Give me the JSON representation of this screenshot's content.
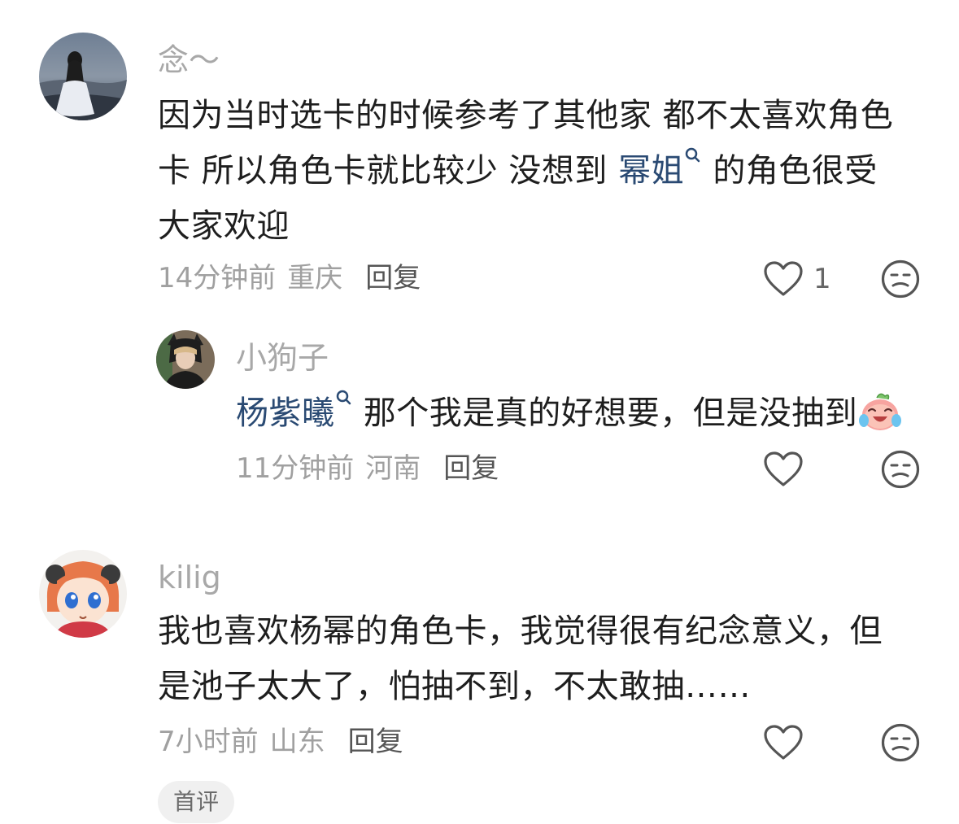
{
  "comments": [
    {
      "username": "念～",
      "line1": "因为当时选卡的时候参考了其他家 都不太喜欢角色",
      "line2_a": "卡 所以角色卡就比较少 没想到 ",
      "line2_mention": "幂姐",
      "line2_b": " 的角色很受",
      "line3": "大家欢迎",
      "time": "14分钟前",
      "location": "重庆",
      "reply": "回复",
      "likes": "1",
      "replies": [
        {
          "username": "小狗子",
          "mention": "杨紫曦",
          "text": " 那个我是真的好想要，但是没抽到",
          "time": "11分钟前",
          "location": "河南",
          "reply": "回复"
        }
      ]
    },
    {
      "username": "kilig",
      "line1": "我也喜欢杨幂的角色卡，我觉得很有纪念意义，但",
      "line2": "是池子太大了，怕抽不到，不太敢抽……",
      "time": "7小时前",
      "location": "山东",
      "reply": "回复",
      "tag": "首评"
    }
  ],
  "icons": {
    "like": "heart-outline-icon",
    "dislike": "unamused-face-icon",
    "mention": "search-magnifier-icon",
    "emoji": "crying-laughing-peach-emoji"
  }
}
